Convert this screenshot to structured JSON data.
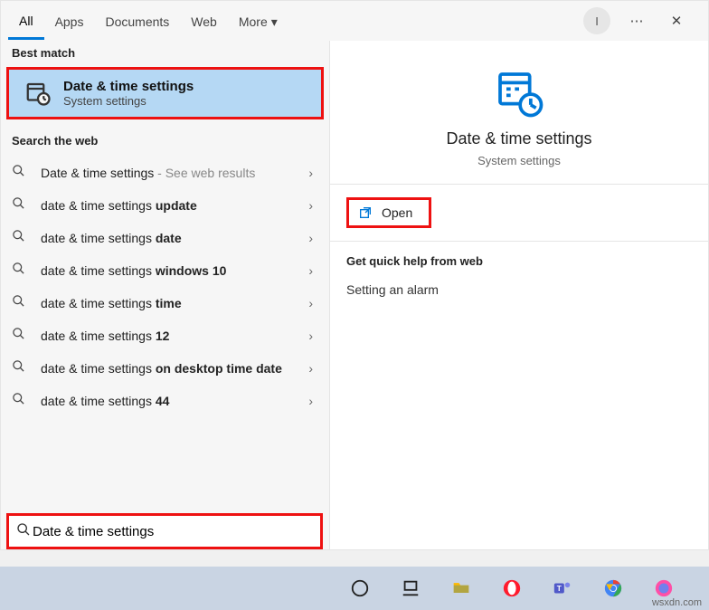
{
  "tabs": {
    "all": "All",
    "apps": "Apps",
    "documents": "Documents",
    "web": "Web",
    "more": "More"
  },
  "section": {
    "best": "Best match",
    "web": "Search the web",
    "help": "Get quick help from web"
  },
  "bestMatch": {
    "title": "Date & time settings",
    "subtitle": "System settings"
  },
  "webResults": [
    {
      "pre": "Date & time settings",
      "bold": "",
      "suffix": " - See web results"
    },
    {
      "pre": "date & time settings ",
      "bold": "update",
      "suffix": ""
    },
    {
      "pre": "date & time settings ",
      "bold": "date",
      "suffix": ""
    },
    {
      "pre": "date & time settings ",
      "bold": "windows 10",
      "suffix": ""
    },
    {
      "pre": "date & time settings ",
      "bold": "time",
      "suffix": ""
    },
    {
      "pre": "date & time settings ",
      "bold": "12",
      "suffix": ""
    },
    {
      "pre": "date & time settings ",
      "bold": "on desktop time date",
      "suffix": ""
    },
    {
      "pre": "date & time settings ",
      "bold": "44",
      "suffix": ""
    }
  ],
  "detail": {
    "title": "Date & time settings",
    "subtitle": "System settings",
    "open": "Open"
  },
  "helpItems": [
    "Setting an alarm"
  ],
  "search": {
    "value": "Date & time settings"
  },
  "avatar": "I",
  "watermark": "wsxdn.com"
}
